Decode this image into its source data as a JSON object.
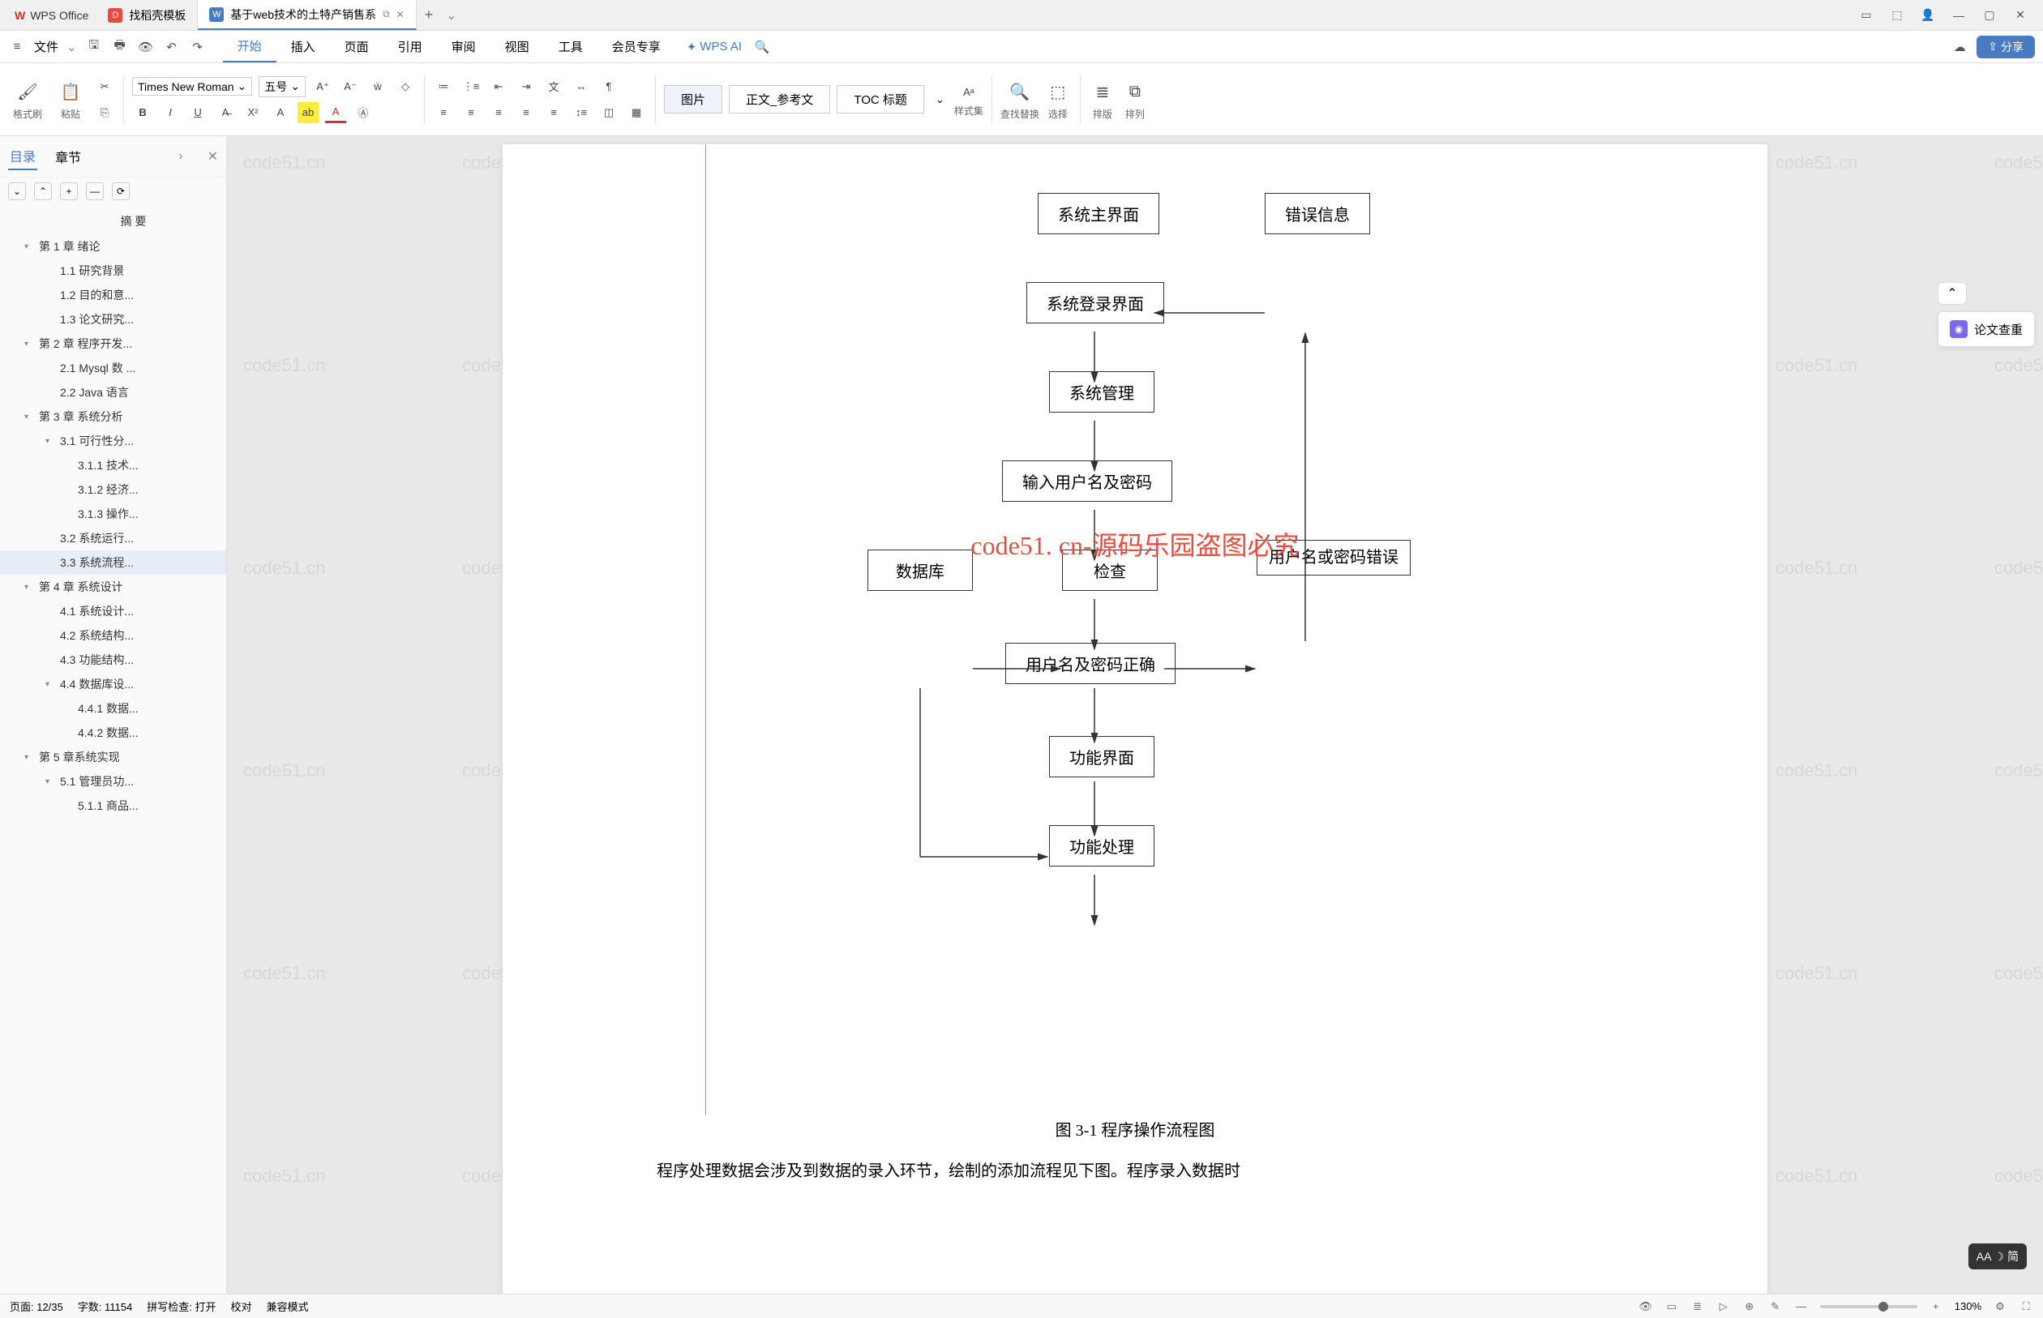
{
  "titlebar": {
    "app_name": "WPS Office",
    "tabs": [
      {
        "icon": "D",
        "icon_color": "#e74c3c",
        "label": "找稻壳模板"
      },
      {
        "icon": "W",
        "icon_color": "#4a7ac2",
        "label": "基于web技术的土特产销售系",
        "active": true
      }
    ]
  },
  "menubar": {
    "file_label": "文件",
    "items": [
      "开始",
      "插入",
      "页面",
      "引用",
      "审阅",
      "视图",
      "工具",
      "会员专享"
    ],
    "active_index": 0,
    "wps_ai": "WPS AI",
    "share": "分享"
  },
  "ribbon": {
    "format_painter": "格式刷",
    "paste": "粘贴",
    "font_name": "Times New Roman",
    "font_size": "五号",
    "styles": {
      "image": "图片",
      "body_ref": "正文_参考文",
      "toc_title": "TOC 标题"
    },
    "style_sets": "样式集",
    "find_replace": "查找替换",
    "select": "选择",
    "sort": "排版",
    "arrange": "排列"
  },
  "outline": {
    "tabs": {
      "toc": "目录",
      "chapters": "章节"
    },
    "abstract": "摘  要",
    "items": [
      {
        "level": 1,
        "label": "第 1 章  绪论",
        "caret": true
      },
      {
        "level": 2,
        "label": "1.1  研究背景"
      },
      {
        "level": 2,
        "label": "1.2 目的和意..."
      },
      {
        "level": 2,
        "label": "1.3  论文研究..."
      },
      {
        "level": 1,
        "label": "第 2 章  程序开发...",
        "caret": true
      },
      {
        "level": 2,
        "label": "2.1  Mysql 数 ..."
      },
      {
        "level": 2,
        "label": "2.2  Java 语言"
      },
      {
        "level": 1,
        "label": "第 3 章  系统分析",
        "caret": true
      },
      {
        "level": 2,
        "label": "3.1  可行性分...",
        "caret": true
      },
      {
        "level": 3,
        "label": "3.1.1  技术..."
      },
      {
        "level": 3,
        "label": "3.1.2  经济..."
      },
      {
        "level": 3,
        "label": "3.1.3  操作..."
      },
      {
        "level": 2,
        "label": "3.2  系统运行..."
      },
      {
        "level": 2,
        "label": "3.3  系统流程...",
        "selected": true
      },
      {
        "level": 1,
        "label": "第 4 章  系统设计",
        "caret": true
      },
      {
        "level": 2,
        "label": "4.1   系统设计..."
      },
      {
        "level": 2,
        "label": "4.2  系统结构..."
      },
      {
        "level": 2,
        "label": "4.3  功能结构..."
      },
      {
        "level": 2,
        "label": "4.4 数据库设...",
        "caret": true
      },
      {
        "level": 3,
        "label": "4.4.1  数据..."
      },
      {
        "level": 3,
        "label": "4.4.2  数据..."
      },
      {
        "level": 1,
        "label": "第 5 章系统实现",
        "caret": true
      },
      {
        "level": 2,
        "label": "5.1  管理员功...",
        "caret": true
      },
      {
        "level": 3,
        "label": "5.1.1   商品..."
      }
    ]
  },
  "document": {
    "watermark_text": "code51.cn",
    "red_watermark": "code51. cn-源码乐园盗图必究",
    "flowchart": {
      "boxes": {
        "b1": "系统主界面",
        "b2": "错误信息",
        "b3": "系统登录界面",
        "b4": "系统管理",
        "b5": "输入用户名及密码",
        "b6": "数据库",
        "b7": "检查",
        "b8": "用户名或密码错误",
        "b9": "用户名及密码正确",
        "b10": "功能界面",
        "b11": "功能处理"
      },
      "caption": "图 3-1  程序操作流程图",
      "body_text": "程序处理数据会涉及到数据的录入环节，绘制的添加流程见下图。程序录入数据时"
    }
  },
  "right_panel": {
    "paper_check": "论文查重"
  },
  "aa_float": "AA ☽ 简",
  "statusbar": {
    "page": "页面: 12/35",
    "words": "字数: 11154",
    "spellcheck": "拼写检查: 打开",
    "proofread": "校对",
    "compat": "兼容模式",
    "zoom": "130%"
  }
}
